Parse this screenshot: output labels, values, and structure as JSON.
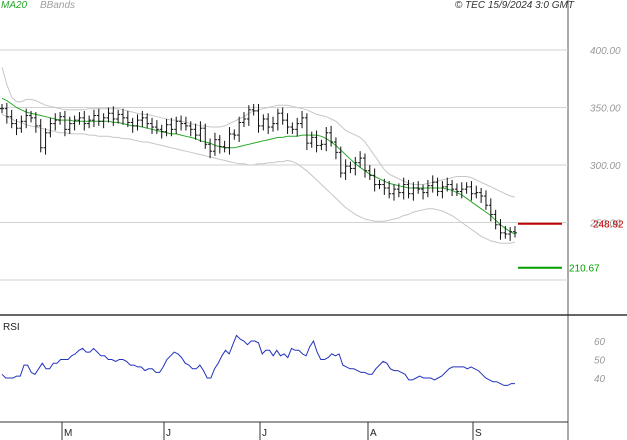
{
  "header": {
    "ma_label": "MA20",
    "bb_label": "BBands",
    "timestamp": "© TEC 15/9/2024 3:0 GMT"
  },
  "colors": {
    "ma": "#2aa82a",
    "bbands": "#c6c6c6",
    "price": "#111111",
    "rsi": "#2233bb",
    "resistance": "#c00000",
    "support": "#00a000",
    "grid": "#d2d2d2",
    "axis": "#555555"
  },
  "chart_data": [
    {
      "type": "ohlc",
      "y_axis": {
        "ticks": [
          "400.00",
          "350.00",
          "300.00",
          "250.00"
        ],
        "ylim": [
          180,
          430
        ]
      },
      "resistance": {
        "value": 248.92,
        "label": "248.92"
      },
      "support": {
        "value": 210.67,
        "label": "210.67"
      },
      "x_axis": {
        "ticks": [
          "M",
          "J",
          "J",
          "A",
          "S"
        ]
      },
      "closes": [
        349,
        342,
        336,
        332,
        338,
        343,
        341,
        334,
        315,
        328,
        336,
        339,
        342,
        331,
        336,
        339,
        341,
        336,
        339,
        343,
        338,
        341,
        345,
        340,
        344,
        341,
        337,
        334,
        339,
        341,
        336,
        333,
        331,
        329,
        335,
        331,
        338,
        336,
        334,
        331,
        326,
        332,
        318,
        312,
        322,
        316,
        315,
        327,
        326,
        337,
        340,
        348,
        347,
        334,
        340,
        333,
        336,
        345,
        339,
        333,
        331,
        336,
        341,
        319,
        324,
        317,
        318,
        328,
        320,
        311,
        293,
        299,
        297,
        302,
        306,
        295,
        291,
        283,
        283,
        280,
        275,
        279,
        276,
        283,
        275,
        280,
        279,
        276,
        282,
        285,
        277,
        281,
        283,
        279,
        277,
        279,
        281,
        275,
        276,
        273,
        265,
        257,
        248,
        241,
        240,
        242,
        241
      ],
      "ma20": [
        358,
        356,
        353,
        350,
        348,
        346,
        345,
        344,
        343,
        342,
        341,
        340,
        339,
        339,
        339,
        338,
        338,
        338,
        338,
        338,
        338,
        338,
        338,
        337,
        337,
        336,
        335,
        334,
        334,
        333,
        332,
        331,
        330,
        329,
        328,
        327,
        327,
        326,
        325,
        324,
        323,
        321,
        320,
        319,
        317,
        316,
        315,
        315,
        315,
        316,
        317,
        318,
        319,
        320,
        321,
        322,
        323,
        324,
        324,
        325,
        325,
        325,
        326,
        326,
        326,
        326,
        325,
        323,
        320,
        317,
        313,
        309,
        305,
        301,
        298,
        295,
        292,
        290,
        288,
        286,
        284,
        283,
        282,
        281,
        280,
        280,
        280,
        280,
        280,
        280,
        280,
        280,
        279,
        278,
        276,
        274,
        271,
        268,
        265,
        262,
        259,
        256,
        252,
        248,
        245,
        242,
        240
      ],
      "bb_upper": [
        385,
        370,
        359,
        355,
        355,
        357,
        357,
        356,
        354,
        352,
        351,
        350,
        349,
        348,
        348,
        348,
        348,
        348,
        349,
        349,
        349,
        349,
        349,
        349,
        349,
        348,
        347,
        346,
        345,
        344,
        344,
        343,
        342,
        341,
        340,
        339,
        339,
        338,
        337,
        336,
        335,
        334,
        334,
        333,
        333,
        333,
        334,
        336,
        338,
        340,
        342,
        345,
        347,
        348,
        349,
        350,
        351,
        352,
        352,
        352,
        351,
        350,
        349,
        348,
        346,
        344,
        343,
        342,
        340,
        338,
        334,
        330,
        328,
        326,
        324,
        320,
        314,
        308,
        302,
        296,
        292,
        290,
        288,
        286,
        284,
        283,
        283,
        283,
        284,
        285,
        286,
        287,
        288,
        289,
        290,
        290,
        290,
        289,
        287,
        285,
        283,
        281,
        279,
        277,
        275,
        273,
        272
      ],
      "bb_lower": [
        344,
        342,
        340,
        338,
        337,
        335,
        334,
        333,
        332,
        331,
        330,
        329,
        328,
        328,
        327,
        327,
        327,
        327,
        326,
        326,
        325,
        325,
        325,
        324,
        324,
        323,
        323,
        322,
        321,
        320,
        320,
        319,
        318,
        317,
        316,
        315,
        314,
        313,
        312,
        311,
        310,
        309,
        308,
        307,
        306,
        305,
        304,
        303,
        302,
        301,
        301,
        300,
        300,
        301,
        301,
        302,
        302,
        303,
        303,
        304,
        303,
        301,
        298,
        295,
        291,
        287,
        283,
        279,
        275,
        271,
        267,
        263,
        260,
        257,
        255,
        253,
        252,
        251,
        251,
        251,
        252,
        253,
        254,
        256,
        257,
        259,
        260,
        261,
        262,
        262,
        261,
        260,
        258,
        256,
        253,
        250,
        247,
        244,
        241,
        238,
        236,
        234,
        233,
        232,
        232,
        232,
        233
      ]
    },
    {
      "type": "line",
      "title": "RSI",
      "y_axis": {
        "ticks": [
          "60",
          "50",
          "40"
        ],
        "ylim": [
          25,
          75
        ]
      },
      "values": [
        42,
        40,
        40,
        40,
        41,
        41,
        47,
        47,
        43,
        42,
        45,
        48,
        45,
        45,
        48,
        48,
        50,
        50,
        50,
        52,
        53,
        55,
        56,
        54,
        54,
        56,
        54,
        52,
        52,
        50,
        50,
        49,
        50,
        50,
        49,
        47,
        47,
        46,
        46,
        44,
        45,
        45,
        43,
        43,
        46,
        50,
        52,
        54,
        53,
        51,
        48,
        47,
        45,
        45,
        47,
        44,
        40,
        40,
        45,
        48,
        52,
        55,
        53,
        58,
        63,
        61,
        60,
        58,
        60,
        60,
        59,
        53,
        55,
        55,
        52,
        55,
        52,
        53,
        51,
        56,
        55,
        55,
        53,
        52,
        57,
        60,
        54,
        50,
        50,
        51,
        53,
        52,
        53,
        47,
        46,
        45,
        45,
        44,
        43,
        43,
        42,
        42,
        45,
        47,
        49,
        48,
        45,
        44,
        44,
        43,
        42,
        39,
        39,
        40,
        41,
        40,
        40,
        40,
        39,
        40,
        41,
        43,
        45,
        46,
        46,
        46,
        46,
        45,
        46,
        45,
        44,
        42,
        40,
        39,
        38,
        38,
        37,
        36,
        36,
        37,
        37
      ]
    }
  ]
}
